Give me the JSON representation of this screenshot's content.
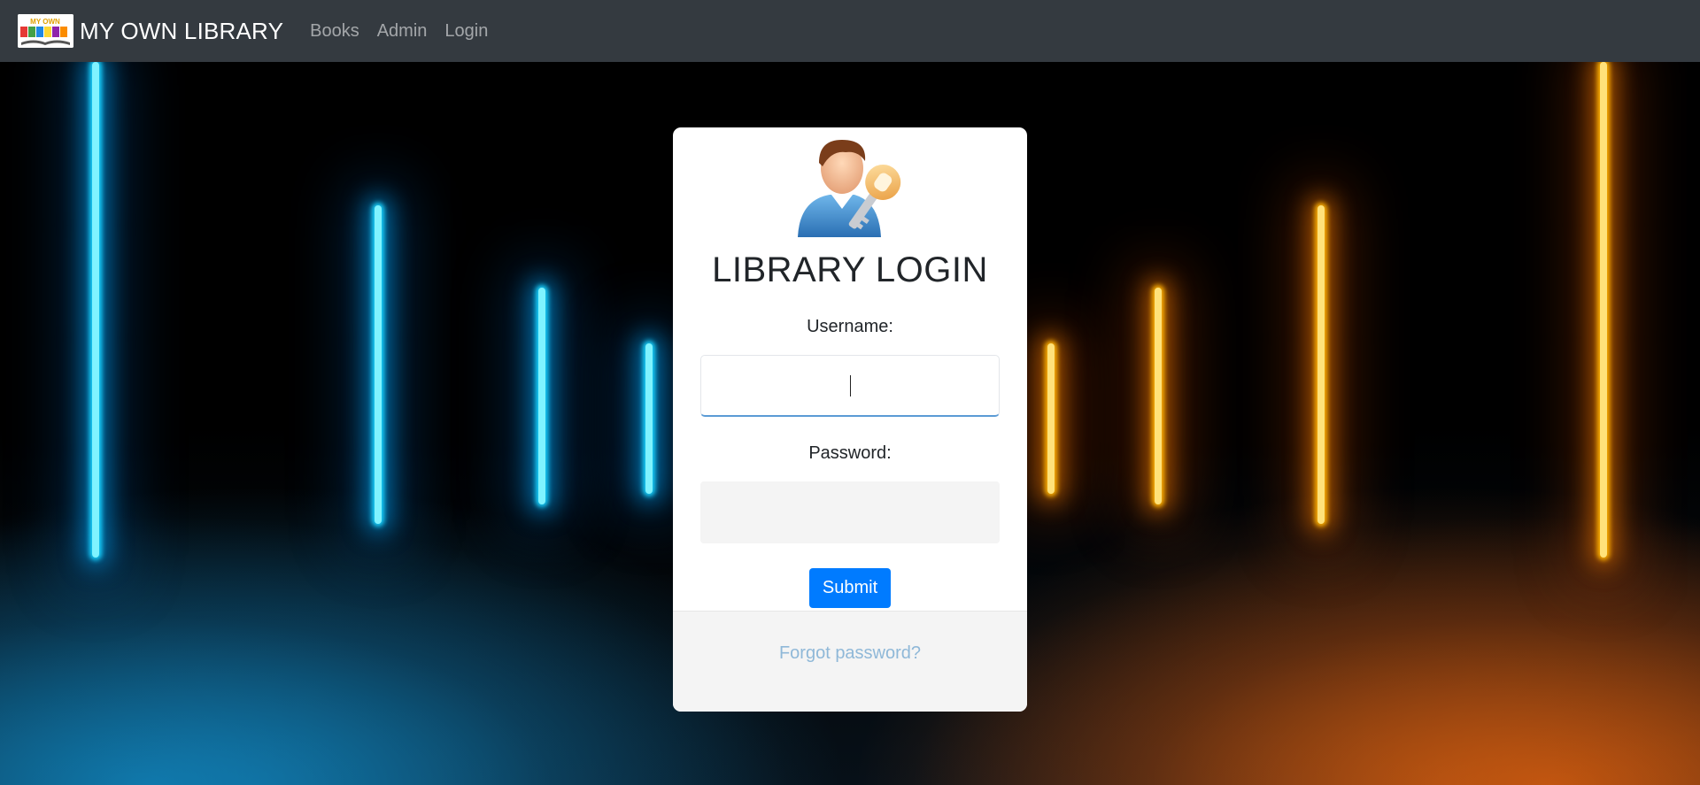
{
  "navbar": {
    "brand": "MY OWN LIBRARY",
    "logo_text": "MY OWN LIBRARY",
    "links": [
      "Books",
      "Admin",
      "Login"
    ]
  },
  "login": {
    "title": "LIBRARY LOGIN",
    "username_label": "Username:",
    "username_value": "",
    "password_label": "Password:",
    "password_value": "",
    "submit_label": "Submit",
    "forgot_label": "Forgot password?"
  },
  "icons": {
    "avatar": "user-key-icon",
    "logo": "library-logo"
  },
  "colors": {
    "navbar_bg": "#343a40",
    "primary": "#007bff",
    "link_muted": "#8fb8d8",
    "accent_blue": "#19d4ff",
    "accent_orange": "#ffb300"
  }
}
